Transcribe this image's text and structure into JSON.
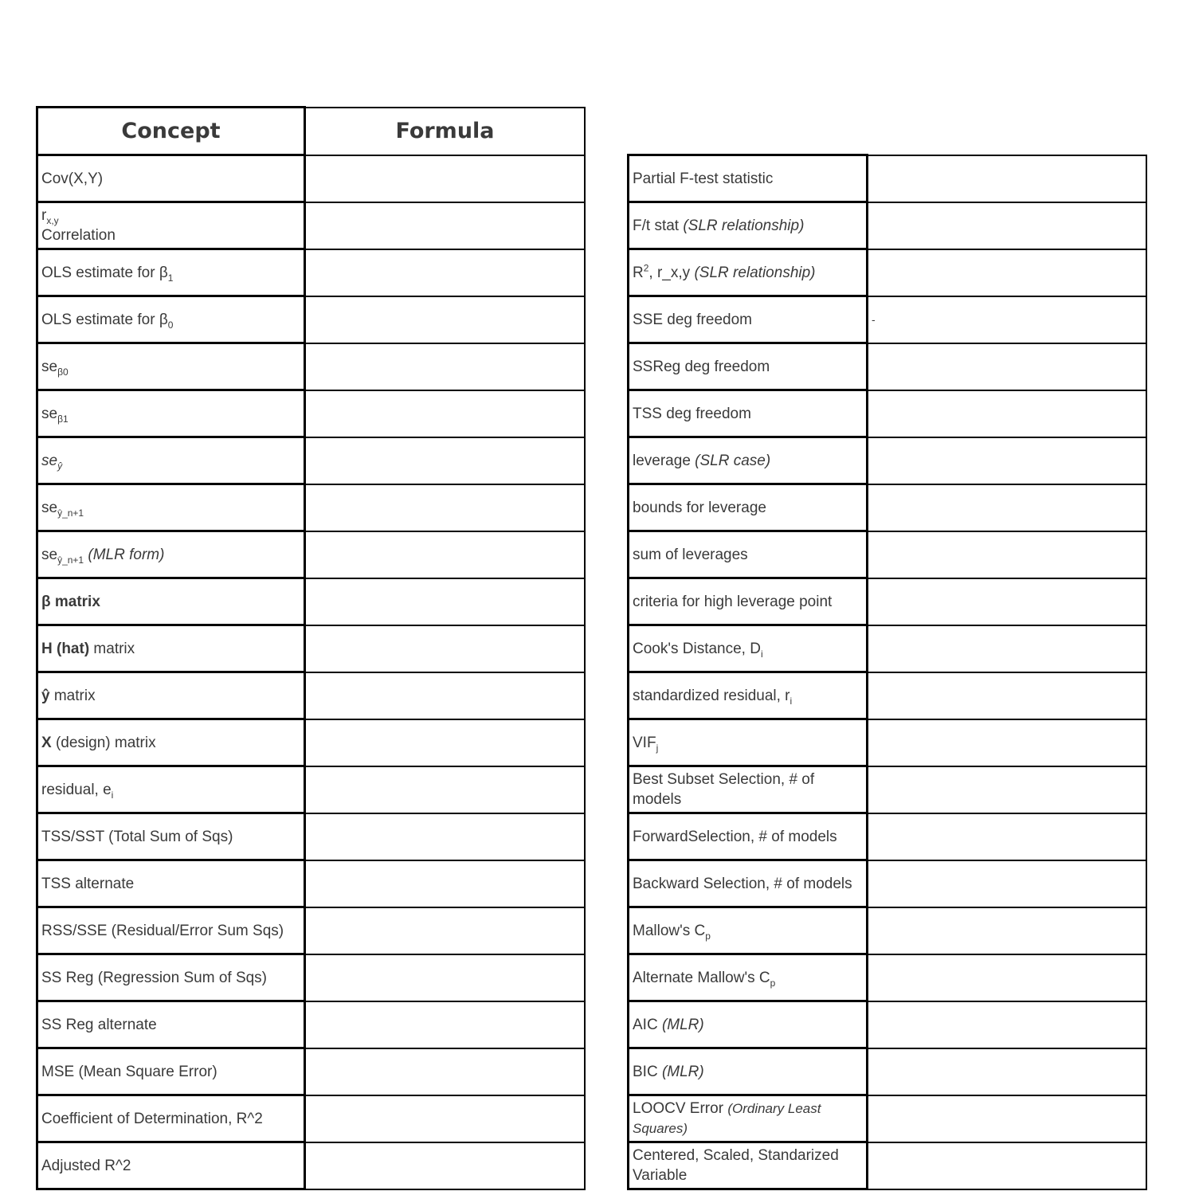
{
  "left_table": {
    "headers": {
      "concept": "Concept",
      "formula": "Formula"
    },
    "rows": [
      {
        "main": "Cov(X,Y)",
        "formula": ""
      },
      {
        "main": "r",
        "sub": "x,y",
        "line2": "Correlation",
        "formula": ""
      },
      {
        "main": "OLS estimate for β",
        "sub": "1",
        "formula": ""
      },
      {
        "main": "OLS estimate for β",
        "sub": "0",
        "formula": ""
      },
      {
        "main": "se",
        "sub": "β0",
        "formula": ""
      },
      {
        "main": "se",
        "sub": "β1",
        "formula": ""
      },
      {
        "main": "se",
        "sub": "ŷ",
        "formula": ""
      },
      {
        "main": "se",
        "sub": "ŷ_n+1",
        "formula": ""
      },
      {
        "main": "se",
        "sub": "ŷ_n+1",
        "note": "(MLR form)",
        "formula": ""
      },
      {
        "bold": "β matrix",
        "formula": ""
      },
      {
        "bold": "H (hat)",
        "main": " matrix",
        "formula": ""
      },
      {
        "bold": "ŷ",
        "main": " matrix",
        "formula": ""
      },
      {
        "bold": "X",
        "main": " (design) matrix",
        "formula": ""
      },
      {
        "main": "residual, e",
        "sub": "i",
        "formula": ""
      },
      {
        "main": "TSS/SST (Total Sum of Sqs)",
        "formula": ""
      },
      {
        "main": "TSS alternate",
        "formula": ""
      },
      {
        "main": "RSS/SSE (Residual/Error Sum Sqs)",
        "formula": ""
      },
      {
        "main": "SS Reg (Regression Sum of Sqs)",
        "formula": ""
      },
      {
        "main": "SS Reg alternate",
        "formula": ""
      },
      {
        "main": "MSE (Mean Square Error)",
        "formula": ""
      },
      {
        "main": "Coefficient of Determination, R^2",
        "formula": ""
      },
      {
        "main": "Adjusted R^2",
        "formula": ""
      }
    ]
  },
  "right_table": {
    "rows": [
      {
        "main": "Partial F-test statistic",
        "formula": ""
      },
      {
        "main": "F/t stat ",
        "note": "(SLR relationship)",
        "formula": ""
      },
      {
        "main": "R",
        "sup": "2",
        "main2": ", r_x,y ",
        "note": "(SLR relationship)",
        "formula": ""
      },
      {
        "main": "SSE deg freedom",
        "formula": "-"
      },
      {
        "main": "SSReg deg freedom",
        "formula": ""
      },
      {
        "main": "TSS deg freedom",
        "formula": ""
      },
      {
        "main": "leverage ",
        "note": "(SLR case)",
        "formula": ""
      },
      {
        "main": "bounds for leverage",
        "formula": ""
      },
      {
        "main": "sum of leverages",
        "formula": ""
      },
      {
        "main": "criteria for high leverage point",
        "formula": ""
      },
      {
        "main": "Cook's Distance, D",
        "sub": "i",
        "formula": ""
      },
      {
        "main": "standardized residual, r",
        "sub": "i",
        "formula": ""
      },
      {
        "main": "VIF",
        "sub": "j",
        "formula": ""
      },
      {
        "main": "Best Subset Selection, # of models",
        "formula": ""
      },
      {
        "main": "ForwardSelection, # of models",
        "formula": ""
      },
      {
        "main": "Backward Selection, # of models",
        "formula": ""
      },
      {
        "main": "Mallow's C",
        "sub": "p",
        "formula": ""
      },
      {
        "main": "Alternate Mallow's C",
        "sub": "p",
        "formula": ""
      },
      {
        "main": "AIC ",
        "note": "(MLR)",
        "formula": ""
      },
      {
        "main": "BIC ",
        "note": "(MLR)",
        "formula": ""
      },
      {
        "main": "LOOCV Error ",
        "small_note": "(Ordinary Least Squares)",
        "formula": ""
      },
      {
        "main": "Centered, Scaled, Standarized Variable",
        "formula": ""
      }
    ]
  }
}
